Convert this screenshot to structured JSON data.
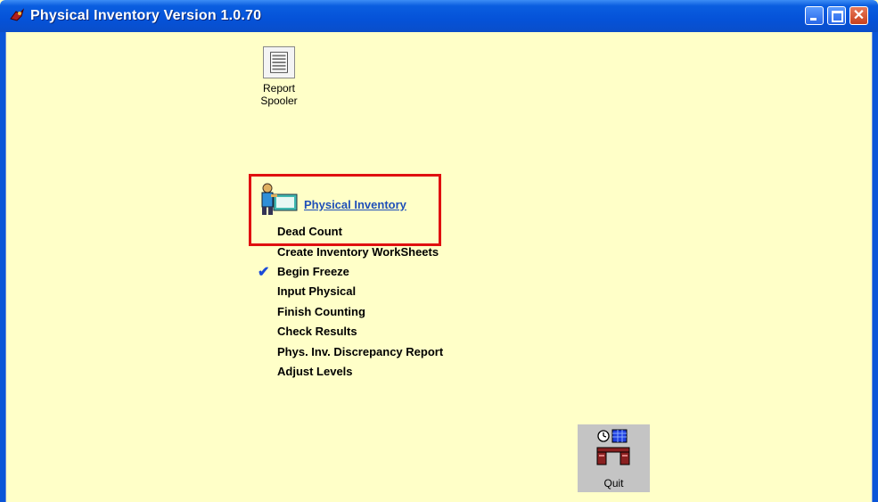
{
  "window": {
    "title": "Physical Inventory Version 1.0.70"
  },
  "shortcuts": {
    "report_spooler": {
      "line1": "Report",
      "line2": "Spooler"
    }
  },
  "inventory": {
    "link_label": "Physical Inventory",
    "items": [
      {
        "label": "Dead Count",
        "checked": false
      },
      {
        "label": "Create Inventory WorkSheets",
        "checked": false
      },
      {
        "label": "Begin Freeze",
        "checked": true
      },
      {
        "label": "Input Physical",
        "checked": false
      },
      {
        "label": "Finish Counting",
        "checked": false
      },
      {
        "label": "Check Results",
        "checked": false
      },
      {
        "label": "Phys. Inv. Discrepancy Report",
        "checked": false
      },
      {
        "label": "Adjust Levels",
        "checked": false
      }
    ]
  },
  "quit": {
    "label": "Quit"
  },
  "colors": {
    "background": "#ffffc8",
    "link": "#1f4fb8",
    "highlight": "#e01010",
    "check": "#1a4ad8"
  },
  "icons": {
    "title": "app-icon",
    "spooler": "report-spooler-icon",
    "inventory": "inventory-worker-icon",
    "quit": "quit-desk-icon",
    "check": "checkmark-icon"
  }
}
